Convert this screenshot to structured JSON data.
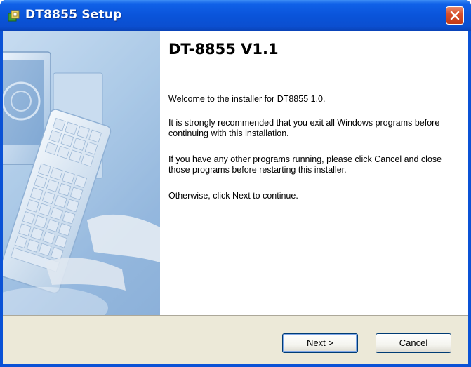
{
  "window": {
    "title": "DT8855 Setup",
    "icon": "installer-icon",
    "close_icon": "close-icon"
  },
  "content": {
    "heading": "DT-8855 V1.1",
    "paragraphs": [
      "Welcome to the installer for DT8855 1.0.",
      "It is strongly recommended that you exit all Windows programs before continuing with this installation.",
      "If you have any other programs running, please click Cancel and close those programs before restarting this installer.",
      "Otherwise, click Next to continue."
    ]
  },
  "buttons": {
    "next_label": "Next >",
    "cancel_label": "Cancel"
  },
  "colors": {
    "titlebar": "#0a54da",
    "close_button": "#d8502c",
    "dialog_background": "#ece9d8",
    "button_border": "#003c74"
  }
}
